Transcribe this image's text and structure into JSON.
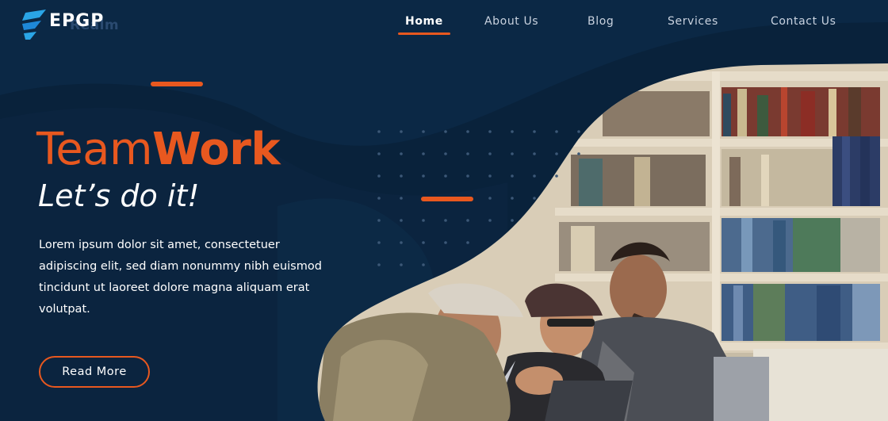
{
  "logo": {
    "text": "EPGP",
    "subtext": "Realm",
    "icon": "stacked-chevron-logo"
  },
  "nav": {
    "items": [
      {
        "label": "Home",
        "active": true
      },
      {
        "label": "About Us",
        "active": false
      },
      {
        "label": "Blog",
        "active": false
      },
      {
        "label": "Services",
        "active": false
      },
      {
        "label": "Contact Us",
        "active": false
      }
    ]
  },
  "hero": {
    "title_light": "Team",
    "title_bold": "Work",
    "subtitle": "Let’s do it!",
    "body": "Lorem ipsum dolor sit amet, consectetuer adipiscing elit, sed diam nonummy nibh euismod tincidunt ut laoreet dolore magna aliquam erat volutpat.",
    "cta_label": "Read More"
  },
  "colors": {
    "background": "#09223b",
    "wave": "#0f3050",
    "accent": "#e8581f",
    "text": "#ffffff"
  }
}
